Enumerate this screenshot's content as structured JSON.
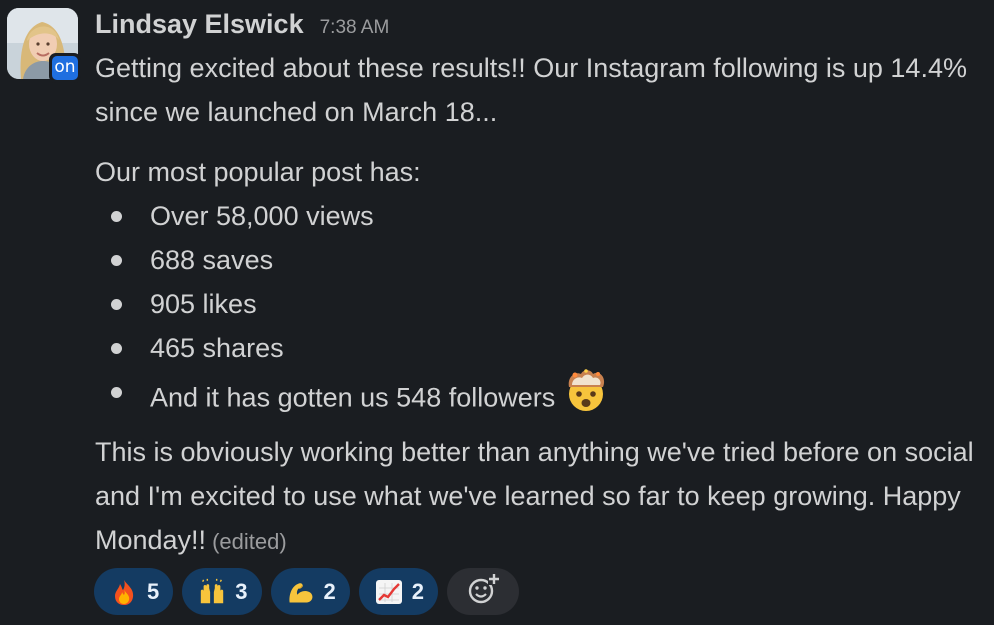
{
  "message": {
    "sender": "Lindsay Elswick",
    "timestamp": "7:38 AM",
    "presence_label": "on",
    "paragraph1": "Getting excited about these results!! Our Instagram following is up 14.4% since we launched on March 18...",
    "paragraph2": "Our most popular post has:",
    "bullets": [
      "Over 58,000 views",
      "688 saves",
      "905 likes",
      "465 shares",
      "And it has gotten us 548 followers"
    ],
    "bullet_emoji": "exploding-head-emoji",
    "paragraph3": "This is obviously working better than anything we've tried before on social and I'm excited to use what we've learned so far to keep growing. Happy Monday!!",
    "edited_label": "(edited)"
  },
  "reactions": [
    {
      "emoji": "fire-emoji",
      "count": "5"
    },
    {
      "emoji": "raising-hands-emoji",
      "count": "3"
    },
    {
      "emoji": "flexed-biceps-emoji",
      "count": "2"
    },
    {
      "emoji": "chart-increasing-emoji",
      "count": "2"
    }
  ],
  "add_reaction_icon": "add-emoji-icon",
  "colors": {
    "background": "#1a1d21",
    "text": "#d1d2d3",
    "muted": "#9b9c9e",
    "reaction_bg": "#143b62",
    "presence": "#1f6fe0"
  }
}
